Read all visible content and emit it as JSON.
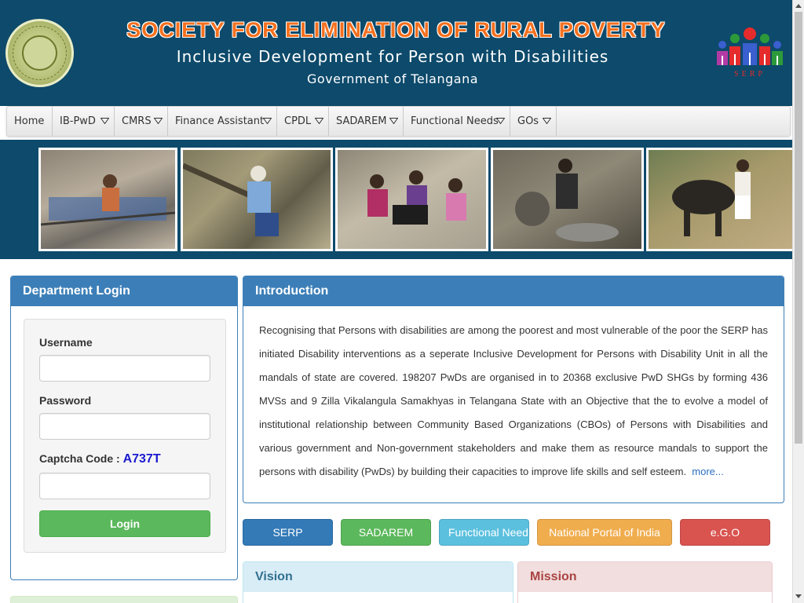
{
  "header": {
    "title": "SOCIETY FOR ELIMINATION OF RURAL POVERTY",
    "subtitle": "Inclusive Development for Person with Disabilities",
    "government": "Government of Telangana",
    "serp_logo_text": "SERP"
  },
  "nav": {
    "items": [
      {
        "label": "Home",
        "has_dropdown": false
      },
      {
        "label": "IB-PwD",
        "has_dropdown": true
      },
      {
        "label": "CMRS",
        "has_dropdown": true
      },
      {
        "label": "Finance Assistant",
        "has_dropdown": true
      },
      {
        "label": "CPDL",
        "has_dropdown": true
      },
      {
        "label": "SADAREM",
        "has_dropdown": true
      },
      {
        "label": "Functional Needs",
        "has_dropdown": true
      },
      {
        "label": "GOs",
        "has_dropdown": true
      }
    ]
  },
  "login": {
    "heading": "Department Login",
    "username_label": "Username",
    "username_value": "",
    "password_label": "Password",
    "password_value": "",
    "captcha_label": "Captcha Code :",
    "captcha_code": "A737T",
    "captcha_value": "",
    "login_button": "Login"
  },
  "intro": {
    "heading": "Introduction",
    "body": "Recognising that Persons with disabilities are among the poorest and most vulnerable of the poor the SERP has initiated Disability interventions as a seperate Inclusive Development for Persons with Disability Unit in all the mandals of state are covered. 198207 PwDs are organised in to 20368 exclusive PwD SHGs by forming 436 MVSs and 9 Zilla Vikalangula Samakhyas in Telangana State with an Objective that the to evolve a model of institutional relationship between Community Based Organizations (CBOs) of Persons with Disabilities and various government and Non-government stakeholders and make them as resource mandals to support the persons with disability (PwDs) by building their capacities to improve life skills and self esteem.",
    "more_link": "more..."
  },
  "link_buttons": [
    {
      "label": "SERP",
      "color": "#337ab7"
    },
    {
      "label": "SADAREM",
      "color": "#5cb85c"
    },
    {
      "label": "Functional Needs",
      "color": "#5bc0de"
    },
    {
      "label": "National Portal of India",
      "color": "#f0ad4e"
    },
    {
      "label": "e.G.O",
      "color": "#d9534f"
    }
  ],
  "vision": {
    "heading": "Vision"
  },
  "mission": {
    "heading": "Mission"
  },
  "colors": {
    "header_bg": "#0d4a6b",
    "title_orange": "#f4701f",
    "panel_blue": "#3c7fb8"
  },
  "icons": [
    "telangana-emblem-icon",
    "serp-logo-icon",
    "dropdown-caret-icon"
  ]
}
